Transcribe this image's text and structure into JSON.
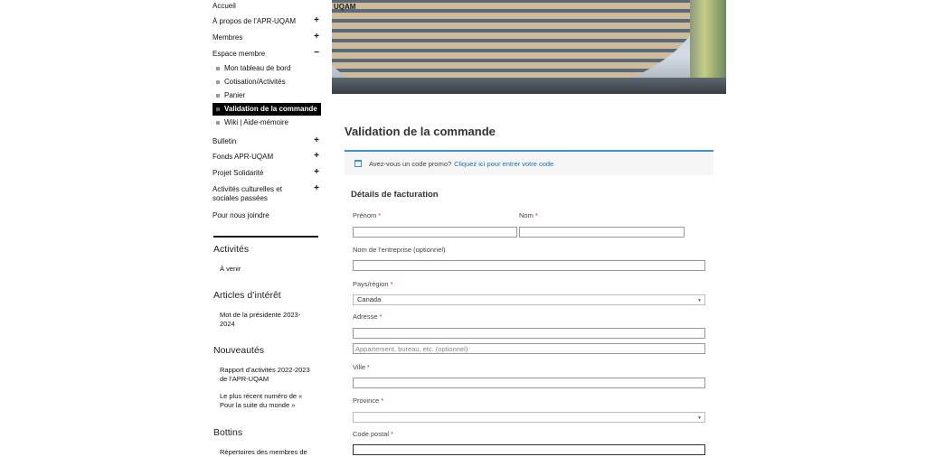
{
  "sidebar": {
    "menu": [
      {
        "label": "Accueil",
        "toggle": ""
      },
      {
        "label": "À propos de l’APR-UQAM",
        "toggle": "+"
      },
      {
        "label": "Membres",
        "toggle": "+"
      },
      {
        "label": "Espace membre",
        "toggle": "−"
      }
    ],
    "submenu": [
      {
        "label": "Mon tableau de bord"
      },
      {
        "label": "Cotisation/Activités"
      },
      {
        "label": "Panier"
      },
      {
        "label": "Validation de la commande"
      },
      {
        "label": "Wiki | Aide-mémoire"
      }
    ],
    "menu2": [
      {
        "label": "Bulletin",
        "toggle": "+"
      },
      {
        "label": "Fonds APR-UQAM",
        "toggle": "+"
      },
      {
        "label": "Projet Solidarité",
        "toggle": "+"
      },
      {
        "label": "Activités culturelles et sociales passées",
        "toggle": "+"
      },
      {
        "label": "Pour nous joindre",
        "toggle": ""
      }
    ],
    "activities_heading": "Activités",
    "activities_link": "À venir",
    "articles_heading": "Articles d’intérêt",
    "articles_link": "Mot de la présidente 2023-2024",
    "news_heading": "Nouveautés",
    "news_link1": "Rapport d’activités 2022-2023 de l’APR-UQAM",
    "news_link2": "Le plus récent numéro de « Pour la suite du monde »",
    "bottins_heading": "Bottins",
    "bottins_link": "Répertoires des membres de"
  },
  "hero": {
    "logo_text": "UQAM"
  },
  "main": {
    "title": "Validation de la commande",
    "promo_text": "Avez-vous un code promo?",
    "promo_link": "Cliquez ici pour entrer votre code",
    "billing_title": "Détails de facturation",
    "required_mark": "*",
    "fields": {
      "first_name": "Prénom",
      "last_name": "Nom",
      "company": "Nom de l’entreprise (optionnel)",
      "country": "Pays/région",
      "country_value": "Canada",
      "address": "Adresse",
      "address2_placeholder": "Appartement, bureau, etc. (optionnel)",
      "city": "Ville",
      "province": "Province",
      "province_value": "",
      "postal": "Code postal"
    }
  }
}
